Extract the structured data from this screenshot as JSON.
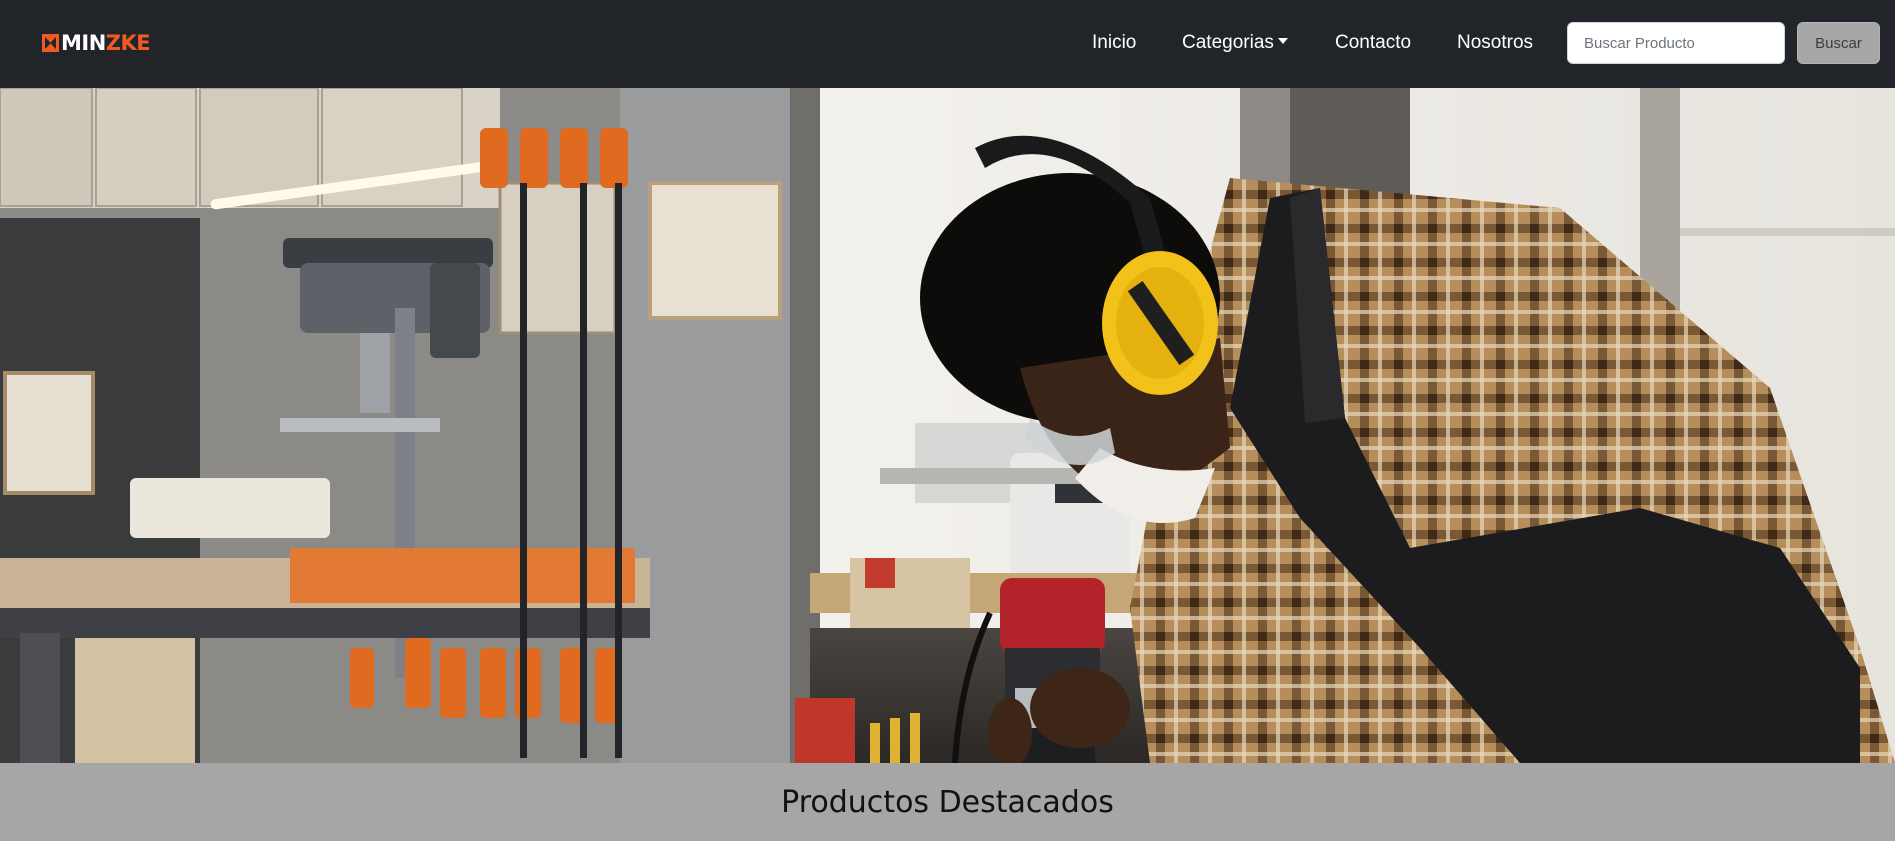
{
  "brand": {
    "name_white": "MIN",
    "name_orange": "ZKE",
    "color_orange": "#f15a22"
  },
  "nav": {
    "inicio": "Inicio",
    "categorias": "Categorias",
    "contacto": "Contacto",
    "nosotros": "Nosotros"
  },
  "search": {
    "placeholder": "Buscar Producto",
    "value": "",
    "button_label": "Buscar"
  },
  "hero": {
    "image_alt": "Carpintero con protectores auditivos usando una fresadora en un taller"
  },
  "featured": {
    "title": "Productos Destacados"
  },
  "colors": {
    "navbar": "#212529",
    "section_background": "#a6a6a6",
    "button_background": "#a7a7a7"
  }
}
